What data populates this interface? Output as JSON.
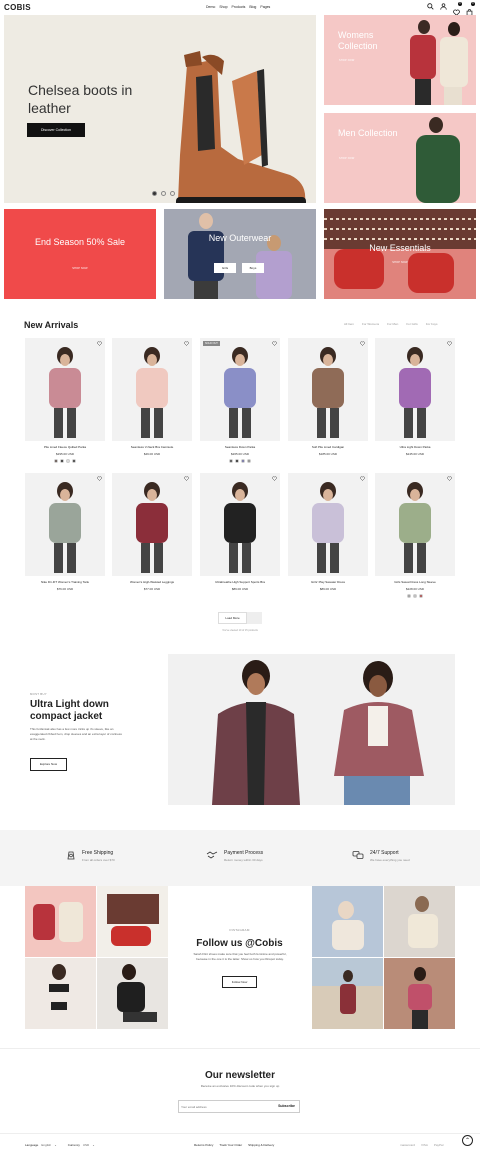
{
  "header": {
    "logo": "COBIS",
    "nav": [
      "Demo",
      "Shop",
      "Products",
      "Blog",
      "Pages"
    ],
    "wishlist_count": "0",
    "cart_count": "0"
  },
  "hero": {
    "title": "Chelsea boots in leather",
    "button": "Discover Collection",
    "slides": 3
  },
  "promos": [
    {
      "title": "Womens Collection",
      "link": "SHOP NOW",
      "bg": "#f5c8c6"
    },
    {
      "title": "Men Collection",
      "link": "SHOP NOW",
      "bg": "#f5c8c6"
    },
    {
      "title": "End Season 50% Sale",
      "link": "SHOP NOW",
      "bg": "#f04a4a"
    },
    {
      "title": "New Outerwear",
      "btn1": "Girls",
      "btn2": "Boys",
      "bg": "#a3a7b3"
    },
    {
      "title": "New Essentials",
      "link": "SHOP NOW",
      "bg": "#e0837c"
    }
  ],
  "arrivals": {
    "title": "New Arrivals",
    "filters": [
      "All Item",
      "For Womens",
      "For Men",
      "For Girls",
      "For boys"
    ],
    "products": [
      {
        "name": "Pile Lined Fleece Quilted Parka",
        "price": "$295.00 USD",
        "swatches": [
          "#5a4a45",
          "#222",
          "#ddd",
          "#333"
        ],
        "bg": "#c98b95"
      },
      {
        "name": "Seamless V-Neck Bra Camisole",
        "price": "$49.00 USD",
        "swatches": [],
        "bg": "#f0c9c0"
      },
      {
        "name": "Seamless Down Parka",
        "price": "$265.00 USD",
        "swatches": [
          "#444",
          "#222",
          "#6a6aa0",
          "#888"
        ],
        "bg": "#8a8fc7",
        "label": "SOLD OUT"
      },
      {
        "name": "Soft Pile Lined Cardigan",
        "price": "$185.00 USD",
        "swatches": [],
        "bg": "#8f6b57"
      },
      {
        "name": "Ultra Light Down Parka",
        "price": "$245.00 USD",
        "swatches": [],
        "bg": "#a16ab4"
      },
      {
        "name": "Nike Dri-FIT Women's Training Tank",
        "price": "$76.00 USD",
        "swatches": [],
        "bg": "#9aa59a"
      },
      {
        "name": "Women's High-Waisted Leggings",
        "price": "$77.00 USD",
        "swatches": [],
        "bg": "#8b2e3a"
      },
      {
        "name": "Ultrabreathe High Support Sports Bra",
        "price": "$89.00 USD",
        "swatches": [],
        "bg": "#222"
      },
      {
        "name": "Girls' Play Sweater Dress",
        "price": "$89.00 USD",
        "swatches": [],
        "bg": "#c9c0d8"
      },
      {
        "name": "Girls Sweat Dress Long Sleeve",
        "price": "$228.00 USD",
        "swatches": [
          "#999",
          "#bbb",
          "#a44"
        ],
        "bg": "#9cae8a"
      }
    ],
    "load_more": "Load More",
    "viewed": "You've viewed 10 of 15 products"
  },
  "feature": {
    "kicker": "MOST BUY",
    "title": "Ultra Light down compact jacket",
    "text": "This funfamiak also has a few more tricks up it's sleeve, like an exaggerated ribbed hem, drop sleeves and an extra layer of coziness at the neck.",
    "button": "Explore Now"
  },
  "services": [
    {
      "title": "Free Shipping",
      "sub": "From all orders over $70"
    },
    {
      "title": "Payment Process",
      "sub": "Return money within 30 days"
    },
    {
      "title": "24/7 Support",
      "sub": "We have everything you need"
    }
  ],
  "instagram": {
    "kicker": "INSTAGRAM",
    "title": "Follow us @Cobis",
    "text": "Sarah Flint shoes make sure that you feel both feminine and powerful, because in the one it is the latter. Show us how you #inspot today.",
    "button": "Follow Now"
  },
  "newsletter": {
    "title": "Our newsletter",
    "sub": "Receive an exclusive 10% discount code when you sign up",
    "placeholder": "Your email address",
    "button": "Subscribe"
  },
  "footer": {
    "language_label": "Language",
    "language": "English",
    "currency_label": "Currency",
    "currency": "USD",
    "links": [
      "Returns Policy",
      "Track Your Order",
      "Shipping & Delivery"
    ],
    "payments": [
      "mastercard",
      "VISA",
      "PayPal"
    ]
  }
}
